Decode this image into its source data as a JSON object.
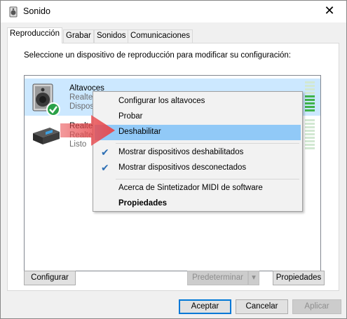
{
  "window": {
    "title": "Sonido",
    "close_glyph": "✕",
    "title_icon": "speaker-icon"
  },
  "tabs": [
    {
      "label": "Reproducción",
      "active": true
    },
    {
      "label": "Grabar",
      "active": false
    },
    {
      "label": "Sonidos",
      "active": false
    },
    {
      "label": "Comunicaciones",
      "active": false
    }
  ],
  "panel": {
    "instructions": "Seleccione un dispositivo de reproducción para modificar su configuración:"
  },
  "devices": [
    {
      "name": "Altavoces",
      "line1": "Realtek",
      "line2": "Dispos",
      "selected": true,
      "icon": "speaker-default-icon",
      "meter": "active"
    },
    {
      "name": "Realtek",
      "line1": "Realtek",
      "line2": "Listo",
      "selected": false,
      "icon": "digital-output-icon",
      "meter": "idle"
    }
  ],
  "context_menu": {
    "items": [
      {
        "label": "Configurar los altavoces",
        "checked": false,
        "highlighted": false,
        "bold": false
      },
      {
        "label": "Probar",
        "checked": false,
        "highlighted": false,
        "bold": false
      },
      {
        "label": "Deshabilitar",
        "checked": false,
        "highlighted": true,
        "bold": false
      },
      {
        "label": "Mostrar dispositivos deshabilitados",
        "checked": true,
        "highlighted": false,
        "bold": false
      },
      {
        "label": "Mostrar dispositivos desconectados",
        "checked": true,
        "highlighted": false,
        "bold": false
      },
      {
        "label": "Acerca de Sintetizador MIDI de software",
        "checked": false,
        "highlighted": false,
        "bold": false
      },
      {
        "label": "Propiedades",
        "checked": false,
        "highlighted": false,
        "bold": true
      }
    ],
    "check_glyph": "✔"
  },
  "buttons": {
    "configure": "Configurar",
    "set_default": "Predeterminar",
    "set_default_arrow": "▾",
    "properties": "Propiedades",
    "ok": "Aceptar",
    "cancel": "Cancelar",
    "apply": "Aplicar"
  },
  "colors": {
    "selection": "#cce8ff",
    "menu_highlight": "#91c9f7",
    "arrow": "#e8474b",
    "meter_green": "#3fb34a",
    "accent": "#0078d7"
  }
}
